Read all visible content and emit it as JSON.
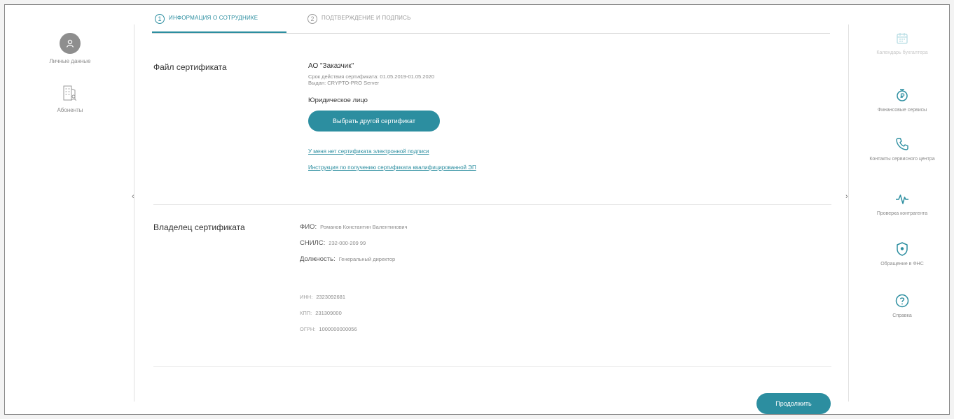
{
  "left_nav": {
    "items": [
      {
        "icon": "user-avatar-icon",
        "label": "Личные данные"
      },
      {
        "icon": "building-user-icon",
        "label": "Абоненты"
      }
    ]
  },
  "tabs": [
    {
      "number": "1",
      "label": "ИНФОРМАЦИЯ О СОТРУДНИКЕ",
      "active": true
    },
    {
      "number": "2",
      "label": "ПОДТВЕРЖДЕНИЕ И ПОДПИСЬ",
      "active": false
    }
  ],
  "certificate_file": {
    "section_label": "Файл сертификата",
    "org_name": "АО \"Заказчик\"",
    "validity": "Срок действия сертификата: 01.05.2019-01.05.2020",
    "issuer": "Выдан: CRYPTO-PRO Server",
    "entity_type": "Юридическое лицо",
    "choose_button": "Выбрать другой сертификат",
    "link_no_cert": "У меня нет сертификата электронной подписи",
    "link_instructions": "Инструкция по получению сертификата квалифицированной ЭП"
  },
  "certificate_owner": {
    "section_label": "Владелец сертификата",
    "fio_label": "ФИО:",
    "fio_value": "Романов Константин Валентинович",
    "snils_label": "СНИЛС:",
    "snils_value": "232-000-209 99",
    "position_label": "Должность:",
    "position_value": "Генеральный директор",
    "inn_label": "ИНН:",
    "inn_value": "2323092681",
    "kpp_label": "КПП:",
    "kpp_value": "231309000",
    "ogrn_label": "ОГРН:",
    "ogrn_value": "1000000000056"
  },
  "continue_button": "Продолжить",
  "right_nav": {
    "items": [
      {
        "icon": "calendar-icon",
        "label": "Календарь бухгалтера",
        "disabled": true
      },
      {
        "icon": "finance-service-icon",
        "label": "Финансовые сервисы",
        "disabled": false
      },
      {
        "icon": "phone-icon",
        "label": "Контакты сервисного центра",
        "disabled": false
      },
      {
        "icon": "pulse-icon",
        "label": "Проверка контрагента",
        "disabled": false
      },
      {
        "icon": "shield-icon",
        "label": "Обращение в ФНС",
        "disabled": false
      },
      {
        "icon": "help-icon",
        "label": "Справка",
        "disabled": false
      }
    ]
  },
  "colors": {
    "accent": "#2c8ea0",
    "muted": "#8a8a8a"
  }
}
